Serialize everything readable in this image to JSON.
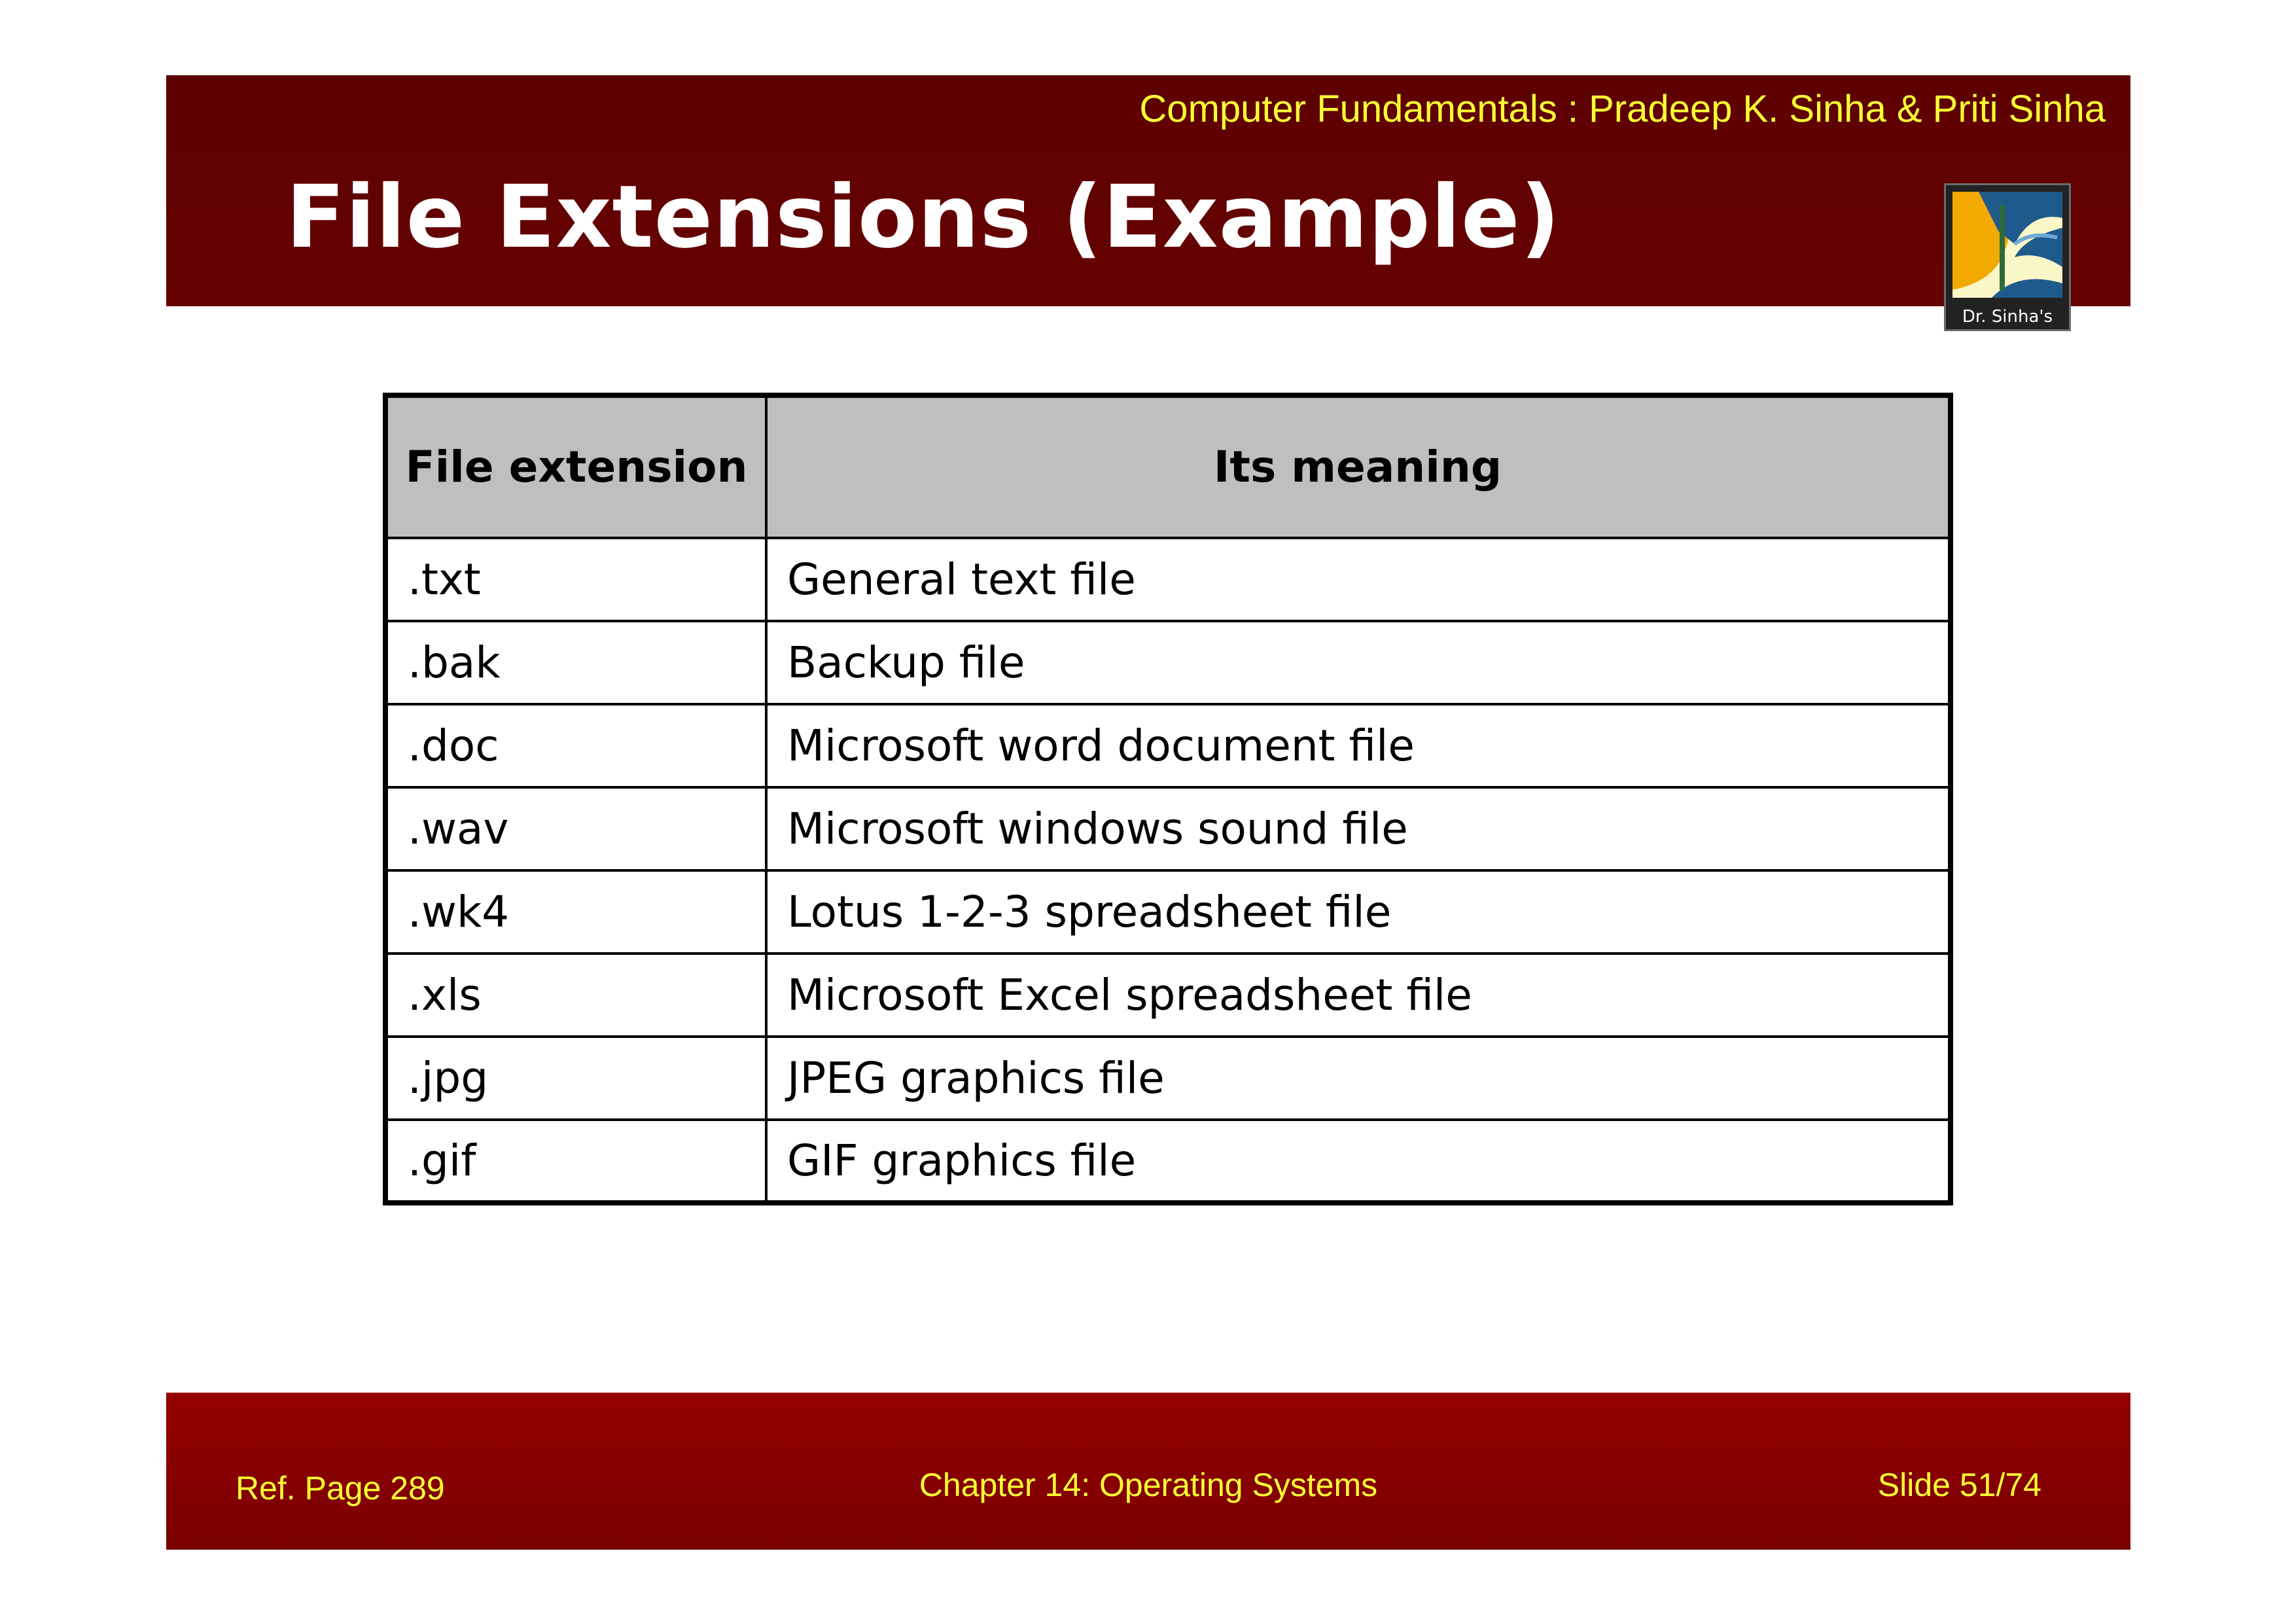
{
  "header": {
    "reference": "Computer Fundamentals : Pradeep K. Sinha & Priti Sinha",
    "title": "File Extensions (Example)",
    "logo_text": "Dr. Sinha's"
  },
  "table": {
    "headers": [
      "File extension",
      "Its meaning"
    ],
    "rows": [
      [
        ".txt",
        "General text file"
      ],
      [
        ".bak",
        "Backup file"
      ],
      [
        ".doc",
        "Microsoft word document file"
      ],
      [
        ".wav",
        "Microsoft windows sound file"
      ],
      [
        ".wk4",
        "Lotus 1-2-3 spreadsheet file"
      ],
      [
        ".xls",
        "Microsoft Excel spreadsheet file"
      ],
      [
        ".jpg",
        "JPEG graphics file"
      ],
      [
        ".gif",
        "GIF graphics file"
      ]
    ]
  },
  "footer": {
    "ref_page": "Ref. Page  289",
    "chapter": "Chapter 14: Operating Systems",
    "slide": "Slide 51/74"
  },
  "colors": {
    "header_bg": "#5e0000",
    "footer_bg": "#940000",
    "accent_text": "#ffff33",
    "table_header_bg": "#bfbfbf"
  }
}
